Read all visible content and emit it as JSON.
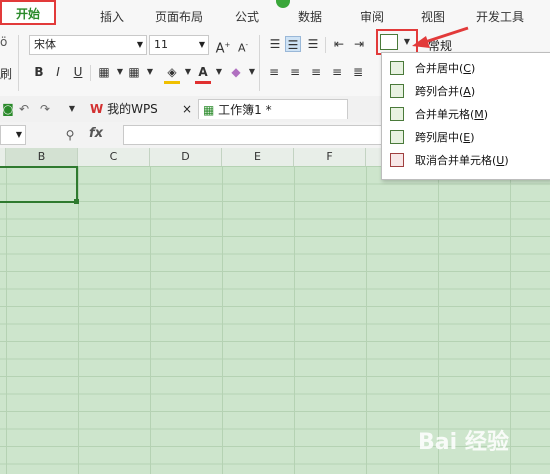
{
  "ribbon_tabs": [
    "开始",
    "插入",
    "页面布局",
    "公式",
    "数据",
    "审阅",
    "视图",
    "开发工具"
  ],
  "font": {
    "name": "宋体",
    "size": "11"
  },
  "number_format": "常规",
  "left_partial": {
    "top": "ö",
    "bottom": "刷"
  },
  "doc_tabs": {
    "wps": "我的WPS",
    "workbook": "工作簿1 *",
    "close": "×"
  },
  "formula": {
    "fx": "fx"
  },
  "columns": [
    "B",
    "C",
    "D",
    "E",
    "F"
  ],
  "merge_menu": {
    "items": [
      {
        "label": "合并居中",
        "key": "C"
      },
      {
        "label": "跨列合并",
        "key": "A"
      },
      {
        "label": "合并单元格",
        "key": "M"
      },
      {
        "label": "跨列居中",
        "key": "E"
      },
      {
        "label": "取消合并单元格",
        "key": "U"
      }
    ]
  },
  "watermark": "Bai 经验",
  "colors": {
    "accent": "#2a8a2a",
    "highlight": "#e23a3a",
    "sheet": "#cde5cc"
  }
}
